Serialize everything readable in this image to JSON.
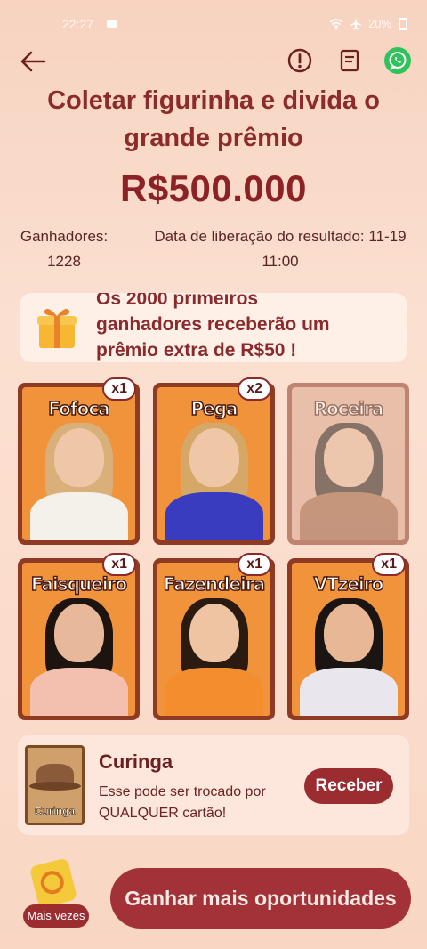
{
  "status_bar": {
    "time": "22:27",
    "battery": "20%"
  },
  "header": {
    "title_line1": "Coletar figurinha e divida o",
    "title_line2": "grande prêmio",
    "prize": "R$500.000",
    "winners_label": "Ganhadores:",
    "winners_count": "1228",
    "release_label": "Data de liberação do resultado: 11-19",
    "release_time": "11:00"
  },
  "banner": {
    "line1": "Os 2000 primeiros",
    "line2": "ganhadores receberão um",
    "line3": "prêmio extra de R$50 !"
  },
  "cards": [
    {
      "name": "Fofoca",
      "count": "x1",
      "locked": false,
      "hair": "#d9b07a",
      "body": "#f4f0ea",
      "skin": "#efc6a8"
    },
    {
      "name": "Pega",
      "count": "x2",
      "locked": false,
      "hair": "#d5a867",
      "body": "#3a3cc0",
      "skin": "#f0c7a6"
    },
    {
      "name": "Roceira",
      "count": "",
      "locked": true,
      "hair": "#2a1a15",
      "body": "#9a5a3a",
      "skin": "#e3b394"
    },
    {
      "name": "Faisqueiro",
      "count": "x1",
      "locked": false,
      "hair": "#1d1410",
      "body": "#f3c0b0",
      "skin": "#e8b89a"
    },
    {
      "name": "Fazendeira",
      "count": "x1",
      "locked": false,
      "hair": "#2a1a10",
      "body": "#f48d2e",
      "skin": "#efc4a2"
    },
    {
      "name": "VTzeiro",
      "count": "x1",
      "locked": false,
      "hair": "#1a1412",
      "body": "#e9e6ee",
      "skin": "#e8b896"
    }
  ],
  "joker": {
    "card_label": "Curinga",
    "title": "Curinga",
    "desc_line1": "Esse pode ser trocado por",
    "desc_line2": "QUALQUER cartão!",
    "button": "Receber"
  },
  "footer": {
    "more_label": "Mais vezes",
    "cta": "Ganhar mais oportunidades"
  },
  "colors": {
    "accent": "#9b2d31",
    "whatsapp": "#31c35b"
  }
}
